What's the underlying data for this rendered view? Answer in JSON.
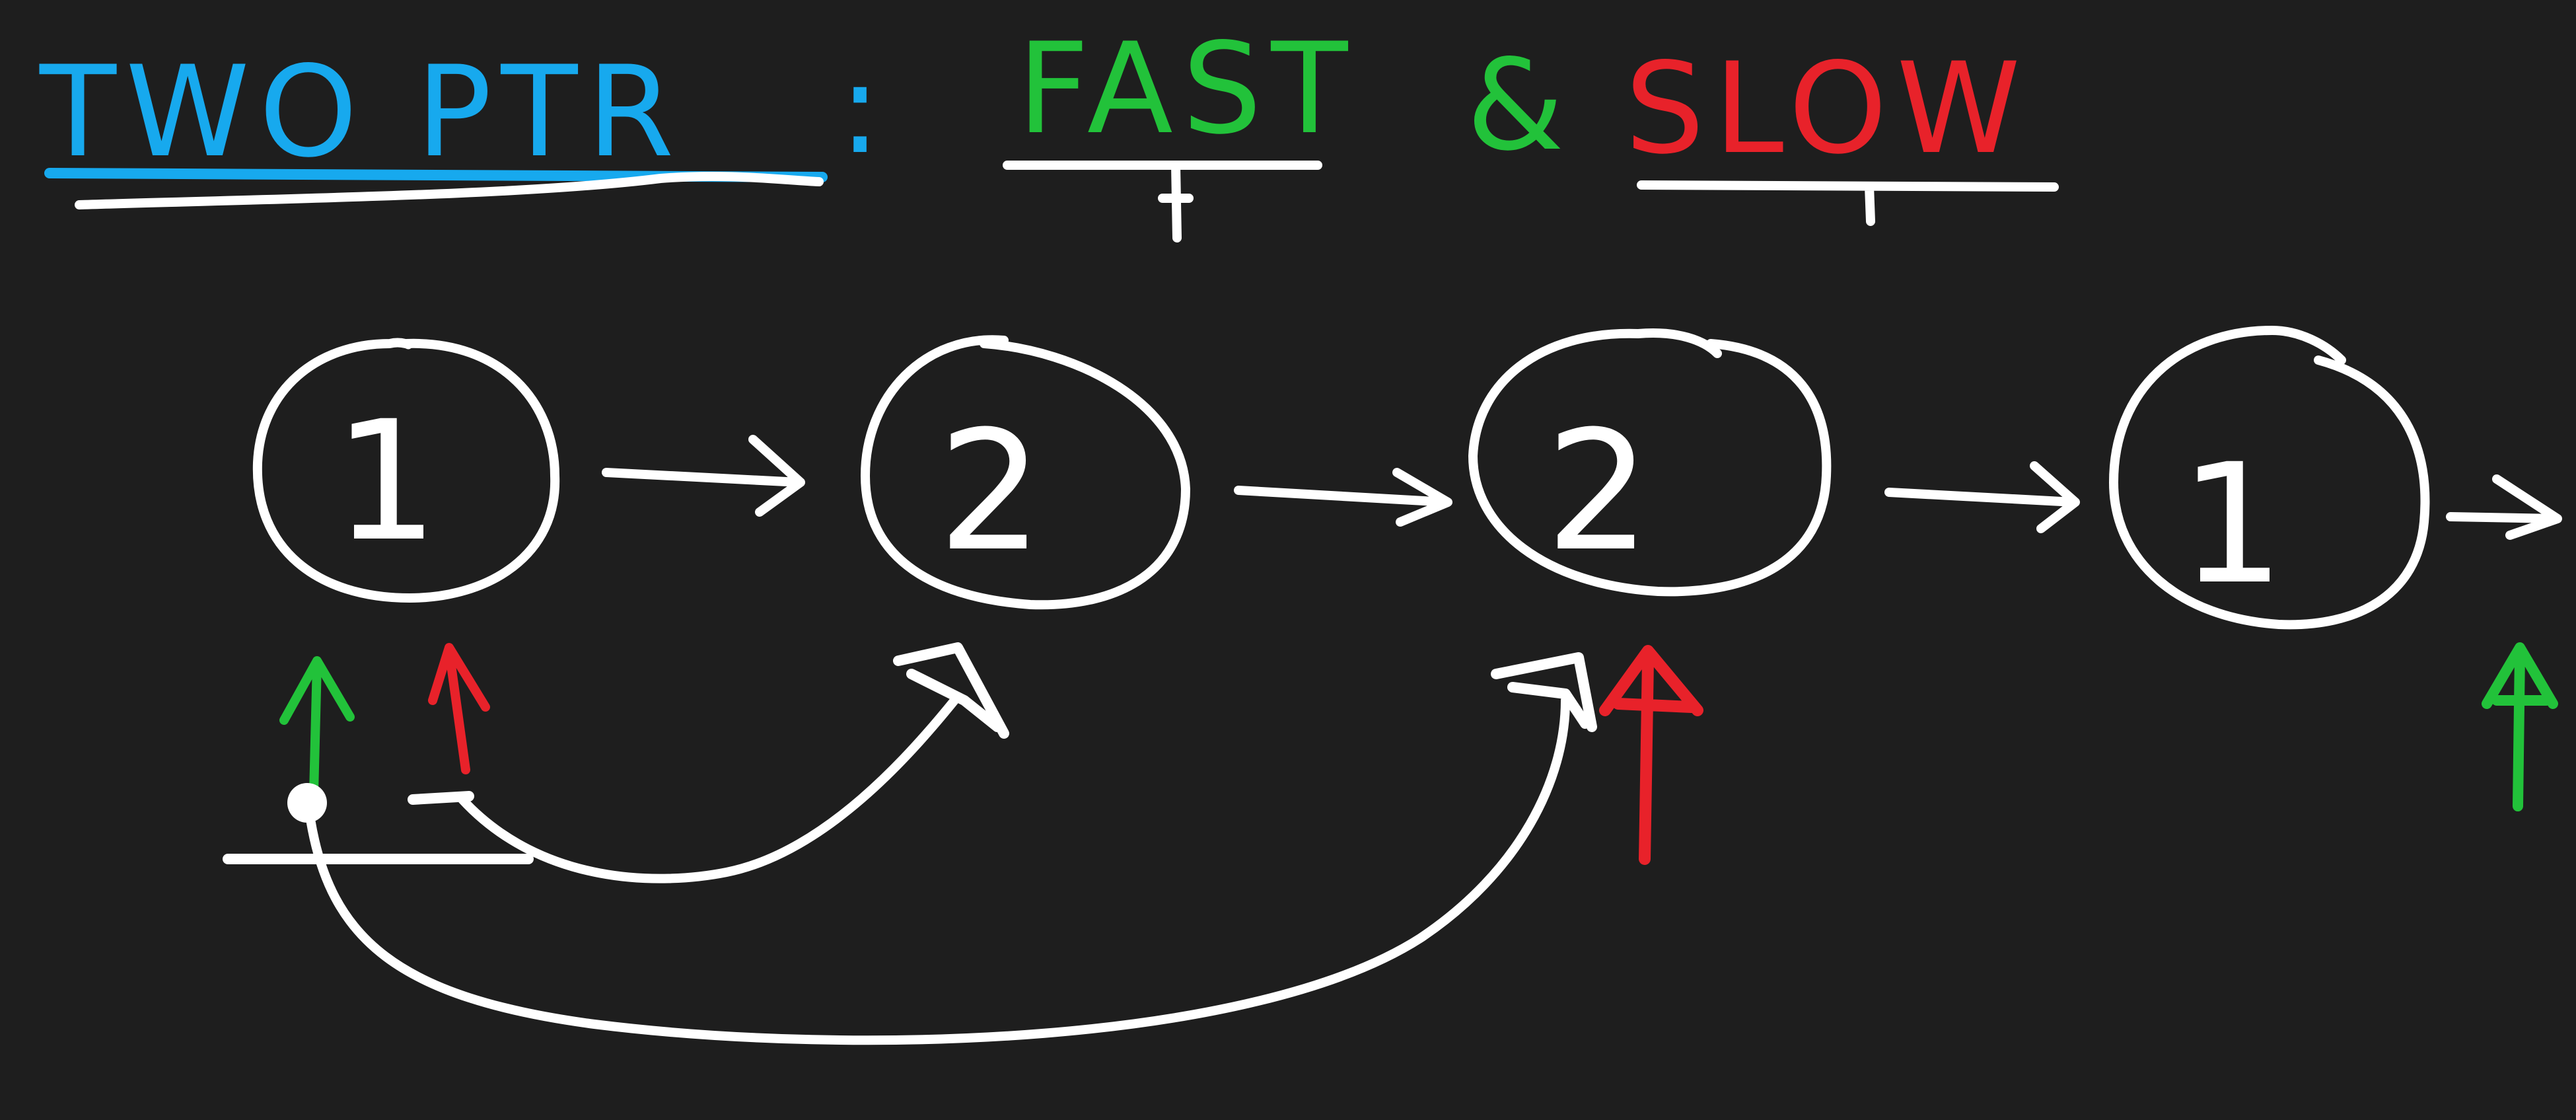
{
  "title": {
    "prefix": "TWO PTR",
    "separator": ":",
    "fast_word": "FAST",
    "ampersand": "&",
    "slow_word": "SLOW"
  },
  "colors": {
    "background": "#1e1e1e",
    "chalk": "#ffffff",
    "title_blue": "#17a9ee",
    "fast_green": "#22c23a",
    "slow_red": "#e8222a"
  },
  "linked_list": {
    "nodes": [
      {
        "value": "1"
      },
      {
        "value": "2"
      },
      {
        "value": "2"
      },
      {
        "value": "1"
      }
    ]
  },
  "pointers": {
    "fast_initial": {
      "color_key": "fast_green",
      "node_index": 0
    },
    "slow_initial": {
      "color_key": "slow_red",
      "node_index": 0
    },
    "slow_after_move": {
      "color_key": "slow_red",
      "node_index": 2
    },
    "fast_after_move": {
      "color_key": "fast_green",
      "past_end": true
    }
  },
  "icons": {
    "next_arrow": "arrow-right-icon",
    "pointer_arrow": "arrow-up-icon"
  }
}
